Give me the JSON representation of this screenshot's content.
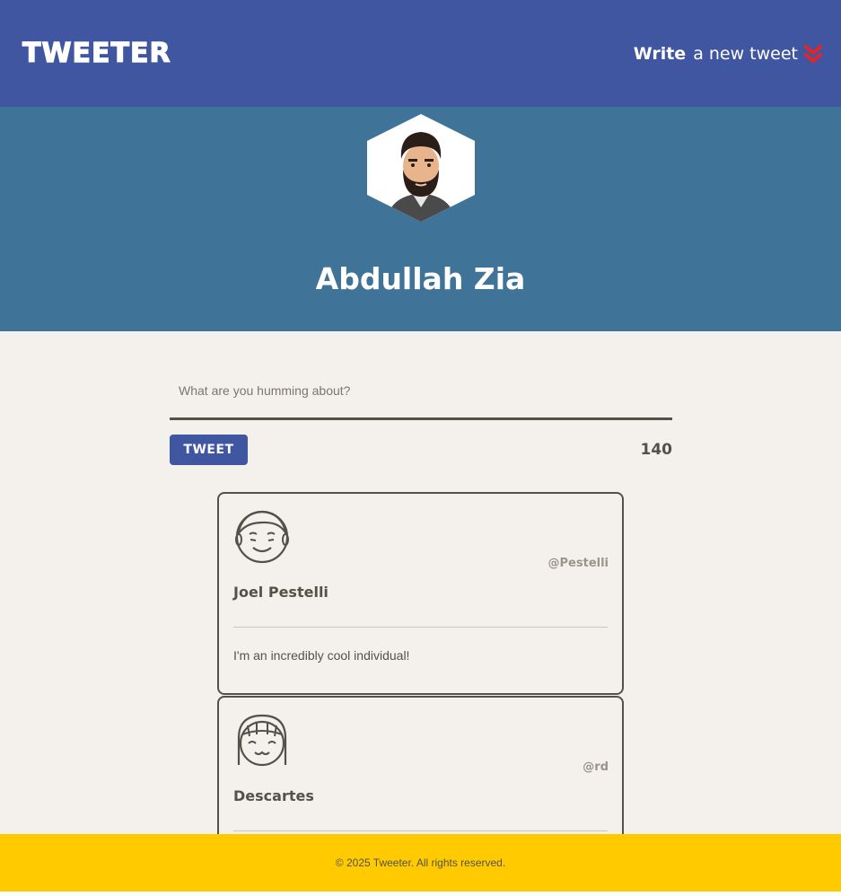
{
  "nav": {
    "brand": "TWEETER",
    "compose_bold": "Write",
    "compose_rest": "a new tweet",
    "compose_icon": "double-chevron-down-icon"
  },
  "profile": {
    "name": "Abdullah Zia",
    "avatar_icon": "user-avatar-bearded-man"
  },
  "composer": {
    "placeholder": "What are you humming about?",
    "button_label": "TWEET",
    "counter": "140"
  },
  "tweets": [
    {
      "author": "Joel Pestelli",
      "handle": "@Pestelli",
      "text": "I'm an incredibly cool individual!",
      "avatar_icon": "smiling-boy-avatar"
    },
    {
      "author": "Descartes",
      "handle": "@rd",
      "text": "",
      "avatar_icon": "smiling-girl-avatar"
    }
  ],
  "footer": {
    "text": "© 2025 Tweeter. All rights reserved."
  },
  "colors": {
    "nav": "#4056a1",
    "hero": "#3f7397",
    "background": "#f4f1ec",
    "text": "#545149",
    "footer": "#ffcb00",
    "chevron": "#e0262b"
  }
}
